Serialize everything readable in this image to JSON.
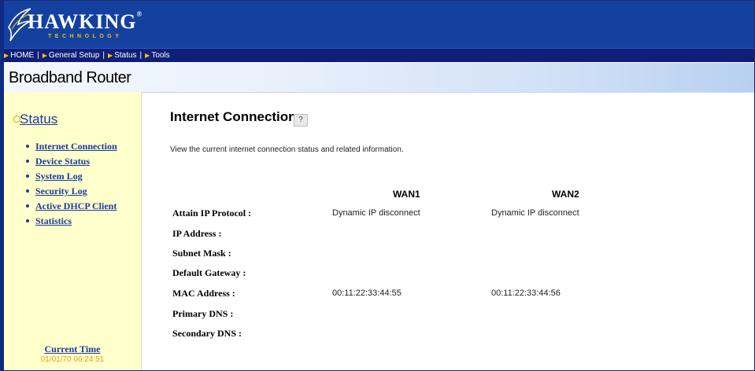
{
  "header": {
    "brand": "HAWKING",
    "brand_mark": "®",
    "tagline": "TECHNOLOGY"
  },
  "nav": {
    "items": [
      {
        "label": "HOME"
      },
      {
        "label": "General Setup"
      },
      {
        "label": "Status"
      },
      {
        "label": "Tools"
      }
    ]
  },
  "product": "Broadband Router",
  "sidebar": {
    "section": "Status",
    "items": [
      {
        "label": "Internet Connection"
      },
      {
        "label": "Device Status"
      },
      {
        "label": "System Log"
      },
      {
        "label": "Security Log"
      },
      {
        "label": "Active DHCP Client"
      },
      {
        "label": "Statistics"
      }
    ],
    "time_label": "Current Time",
    "time_value": "01/01/70 06:24:51"
  },
  "main": {
    "title": "Internet Connection",
    "help_icon": "?",
    "description": "View the current internet connection status and related information.",
    "columns": [
      "WAN1",
      "WAN2"
    ],
    "rows": [
      {
        "label": "Attain IP Protocol :",
        "wan1": "Dynamic IP disconnect",
        "wan2": "Dynamic IP disconnect"
      },
      {
        "label": "IP Address :",
        "wan1": "",
        "wan2": ""
      },
      {
        "label": "Subnet Mask :",
        "wan1": "",
        "wan2": ""
      },
      {
        "label": "Default Gateway :",
        "wan1": "",
        "wan2": ""
      },
      {
        "label": "MAC Address :",
        "wan1": "00:11:22:33:44:55",
        "wan2": "00:11:22:33:44:56"
      },
      {
        "label": "Primary DNS :",
        "wan1": "",
        "wan2": ""
      },
      {
        "label": "Secondary DNS :",
        "wan1": "",
        "wan2": ""
      }
    ]
  },
  "colors": {
    "header_bg": "#1440a0",
    "nav_bg": "#0f1f78",
    "sidebar_bg": "#ffffcc",
    "link": "#1a3aa0",
    "accent": "#f2c200",
    "time_color": "#e4a020"
  }
}
